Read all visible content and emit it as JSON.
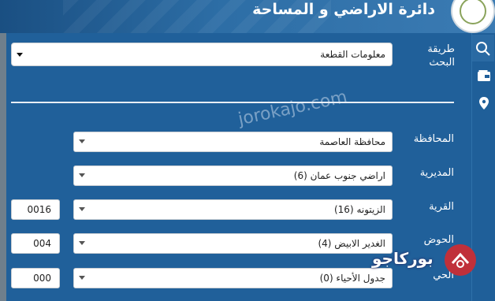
{
  "header": {
    "title": "دائرة الاراضي و المساحة"
  },
  "search": {
    "method_label": "طريقة البحث",
    "method_value": "معلومات القطعة"
  },
  "form": {
    "governorate": {
      "label": "المحافظة",
      "value": "محافظة العاصمة"
    },
    "directorate": {
      "label": "المديرية",
      "value": "اراضي جنوب عمان (6)"
    },
    "village": {
      "label": "القرية",
      "value": "الزيتونه (16)",
      "code": "0016"
    },
    "basin": {
      "label": "الحوض",
      "value": "الغدير الابيض (4)",
      "code": "004"
    },
    "neighborhood": {
      "label": "الحي",
      "value": "جدول الأحياء (0)",
      "code": "000"
    }
  },
  "watermark": "jorokajo.com",
  "brand": {
    "text": "بوركاجو"
  },
  "icons": [
    "search-icon",
    "wallet-icon",
    "location-pin-icon"
  ]
}
